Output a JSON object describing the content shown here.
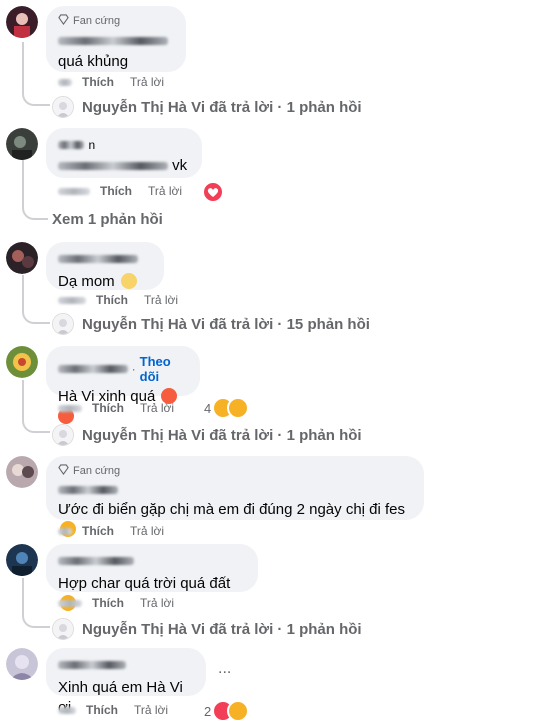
{
  "common": {
    "like": "Thích",
    "reply": "Trả lời",
    "fan_badge": "Fan cứng"
  },
  "comments": [
    {
      "text": "quá khủng",
      "fan": true,
      "reply_summary": "Nguyễn Thị Hà Vi đã trả lời · 1 phản hồi"
    },
    {
      "text_suffix": "vk",
      "view_replies": "Xem 1 phản hồi"
    },
    {
      "text": "Dạ mom",
      "reply_summary": "Nguyễn Thị Hà Vi đã trả lời · 15 phản hồi"
    },
    {
      "follow": "Theo dõi",
      "text": "Hà Vi xinh quá",
      "reaction_count": "4",
      "reply_summary": "Nguyễn Thị Hà Vi đã trả lời · 1 phản hồi"
    },
    {
      "fan": true,
      "text": "Ước đi biển gặp chị mà em đi đúng 2 ngày chị đi fes"
    },
    {
      "text": "Hợp char quá trời quá đất",
      "reply_summary": "Nguyễn Thị Hà Vi đã trả lời · 1 phản hồi"
    },
    {
      "text": "Xinh quá em Hà Vi ơi",
      "reaction_count": "2",
      "more": "..."
    }
  ],
  "colors": {
    "bubble": "#f0f2f5",
    "muted": "#65676b",
    "link": "#0064d1",
    "love": "#f33e58",
    "haha": "#f7b125"
  }
}
